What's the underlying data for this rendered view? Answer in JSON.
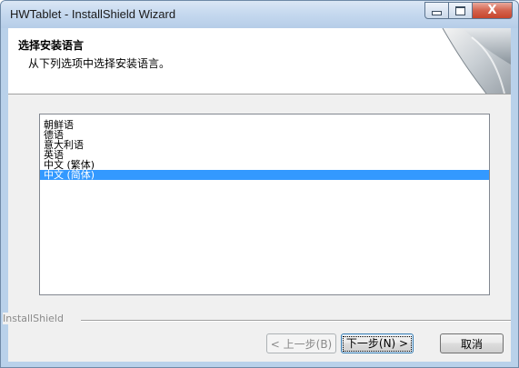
{
  "window": {
    "title": "HWTablet - InstallShield Wizard",
    "controls": {
      "minimize_icon": "minimize-icon",
      "maximize_icon": "maximize-icon",
      "close_icon": "close-icon",
      "close_glyph": "X"
    }
  },
  "header": {
    "title": "选择安装语言",
    "subtitle": "从下列选项中选择安装语言。"
  },
  "language_list": {
    "items": [
      "朝鲜语",
      "德语",
      "意大利语",
      "英语",
      "中文 (繁体)",
      "中文 (简体)"
    ],
    "selected_index": 5,
    "selected_color": "#3399ff"
  },
  "footer": {
    "brand": "InstallShield"
  },
  "buttons": {
    "back": "< 上一步(B)",
    "next": "下一步(N) >",
    "cancel": "取消"
  }
}
